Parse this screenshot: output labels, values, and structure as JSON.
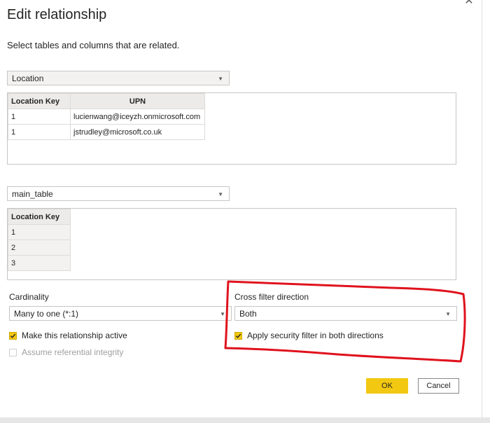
{
  "dialog": {
    "title": "Edit relationship",
    "subtitle": "Select tables and columns that are related.",
    "close_glyph": "✕"
  },
  "table1": {
    "selected": "Location",
    "columns": [
      "Location Key",
      "UPN"
    ],
    "rows": [
      [
        "1",
        "lucienwang@iceyzh.onmicrosoft.com"
      ],
      [
        "1",
        "jstrudley@microsoft.co.uk"
      ]
    ]
  },
  "table2": {
    "selected": "main_table",
    "columns": [
      "Location Key"
    ],
    "rows": [
      [
        "1"
      ],
      [
        "2"
      ],
      [
        "3"
      ]
    ]
  },
  "cardinality": {
    "label": "Cardinality",
    "value": "Many to one (*:1)"
  },
  "cross_filter": {
    "label": "Cross filter direction",
    "value": "Both"
  },
  "options": {
    "active_label": "Make this relationship active",
    "active_checked": true,
    "integrity_label": "Assume referential integrity",
    "integrity_checked": false,
    "security_label": "Apply security filter in both directions",
    "security_checked": true
  },
  "buttons": {
    "ok": "OK",
    "cancel": "Cancel"
  },
  "colors": {
    "accent": "#f2c811",
    "annotation": "#e0121d"
  },
  "icons": {
    "dropdown": "chevron-down-icon",
    "checkmark": "checkmark-icon",
    "close": "close-icon"
  }
}
